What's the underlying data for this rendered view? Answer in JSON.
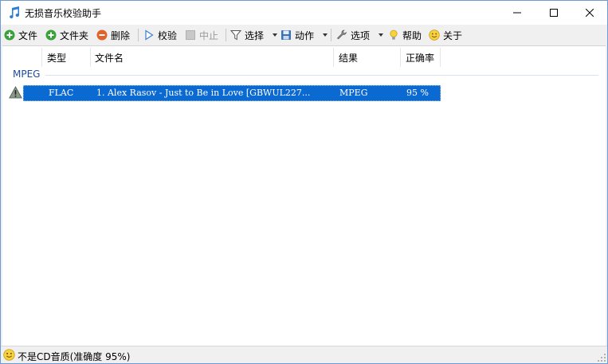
{
  "window": {
    "title": "无损音乐校验助手"
  },
  "toolbar": {
    "file_label": "文件",
    "folder_label": "文件夹",
    "delete_label": "删除",
    "verify_label": "校验",
    "stop_label": "中止",
    "select_label": "选择",
    "action_label": "动作",
    "options_label": "选项",
    "help_label": "帮助",
    "about_label": "关于"
  },
  "list": {
    "columns": [
      "类型",
      "文件名",
      "结果",
      "正确率"
    ],
    "group": "MPEG",
    "rows": [
      {
        "status_icon": "warning-icon",
        "type": "FLAC",
        "filename": "1. Alex Rasov - Just to Be in Love  [GBWUL227...",
        "result": "MPEG",
        "accuracy": "95 %"
      }
    ]
  },
  "status": {
    "text": "不是CD音质(准确度 95%)"
  },
  "colors": {
    "selection": "#0a6ad1",
    "group_text": "#1e4b9e",
    "add_green": "#3aa03a",
    "delete_orange": "#e0622a"
  }
}
